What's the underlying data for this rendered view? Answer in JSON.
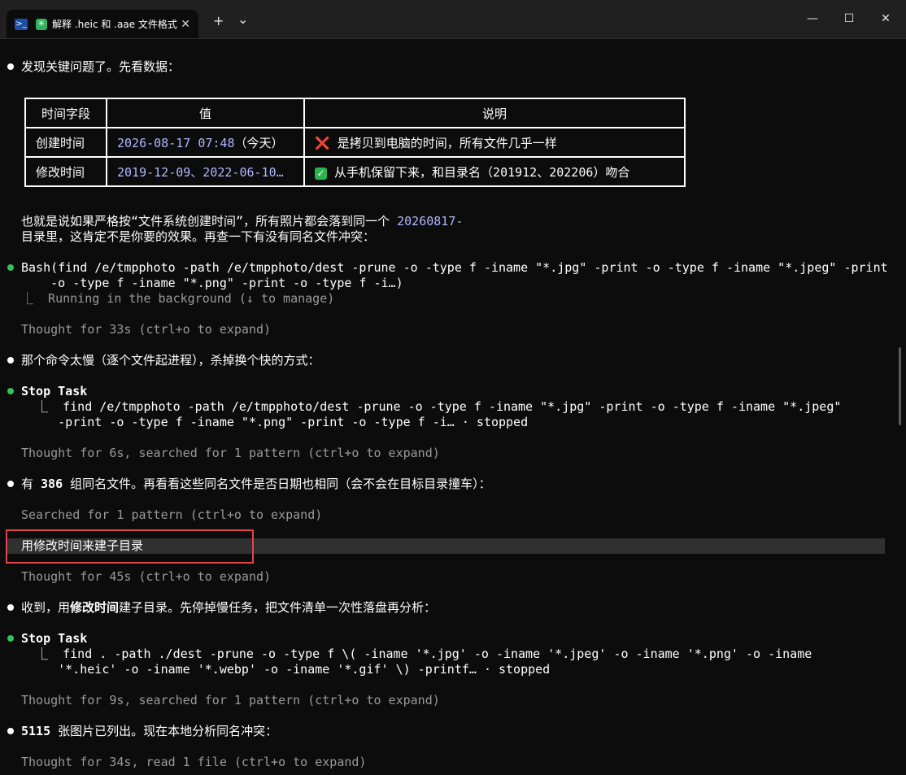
{
  "window": {
    "tab_title": "解释 .heic 和 .aae 文件格式",
    "new_tab": "+",
    "dropdown": "⌄",
    "minimize": "—",
    "maximize": "☐",
    "close": "✕",
    "tab_close": "✕"
  },
  "lines": {
    "l1": "发现关键问题了。先看数据：",
    "l2a": "也就是说如果严格按“文件系统创建时间”，所有照片都会落到同一个 ",
    "l2b": "20260817-",
    "l3": "目录里，这肯定不是你要的效果。再查一下有没有同名文件冲突：",
    "l4": "Bash(find /e/tmpphoto -path /e/tmpphoto/dest -prune -o -type f -iname \"*.jpg\" -print -o -type f -iname \"*.jpeg\" -print",
    "l5": "    -o -type f -iname \"*.png\" -print -o -type f -i…)",
    "l6": "⎿  Running in the background (↓ to manage)",
    "l7": "Thought for 33s (ctrl+o to expand)",
    "l8": "那个命令太慢（逐个文件起进程），杀掉换个快的方式：",
    "l9": "Stop Task",
    "l10": "  ⎿  find /e/tmpphoto -path /e/tmpphoto/dest -prune -o -type f -iname \"*.jpg\" -print -o -type f -iname \"*.jpeg\"",
    "l11": "     -print -o -type f -iname \"*.png\" -print -o -type f -i… · stopped",
    "l12": "Thought for 6s, searched for 1 pattern (ctrl+o to expand)",
    "l13a": "有 ",
    "l13b": "386",
    "l13c": " 组同名文件。再看看这些同名文件是否日期也相同（会不会在目标目录撞车）：",
    "l14": "Searched for 1 pattern (ctrl+o to expand)",
    "l15": "用修改时间来建子目录",
    "l16": "Thought for 45s (ctrl+o to expand)",
    "l17a": "收到，用",
    "l17b": "修改时间",
    "l17c": "建子目录。先停掉慢任务，把文件清单一次性落盘再分析：",
    "l18": "Stop Task",
    "l19": "  ⎿  find . -path ./dest -prune -o -type f \\( -iname '*.jpg' -o -iname '*.jpeg' -o -iname '*.png' -o -iname",
    "l20": "     '*.heic' -o -iname '*.webp' -o -iname '*.gif' \\) -printf… · stopped",
    "l21": "Thought for 9s, searched for 1 pattern (ctrl+o to expand)",
    "l22a": "5115",
    "l22b": " 张图片已列出。现在本地分析同名冲突：",
    "l23": "Thought for 34s, read 1 file (ctrl+o to expand)"
  },
  "table": {
    "headers": [
      "时间字段",
      "值",
      "说明"
    ],
    "rows": [
      {
        "field": "创建时间",
        "value": "2026-08-17 07:48",
        "value_suffix": "（今天）",
        "mark": "❌",
        "note": "是拷贝到电脑的时间，所有文件几乎一样"
      },
      {
        "field": "修改时间",
        "value": "2019-12-09、2022-06-10…",
        "value_suffix": "",
        "mark": "✓",
        "note": "从手机保留下来，和目录名（201912、202206）吻合"
      }
    ]
  }
}
